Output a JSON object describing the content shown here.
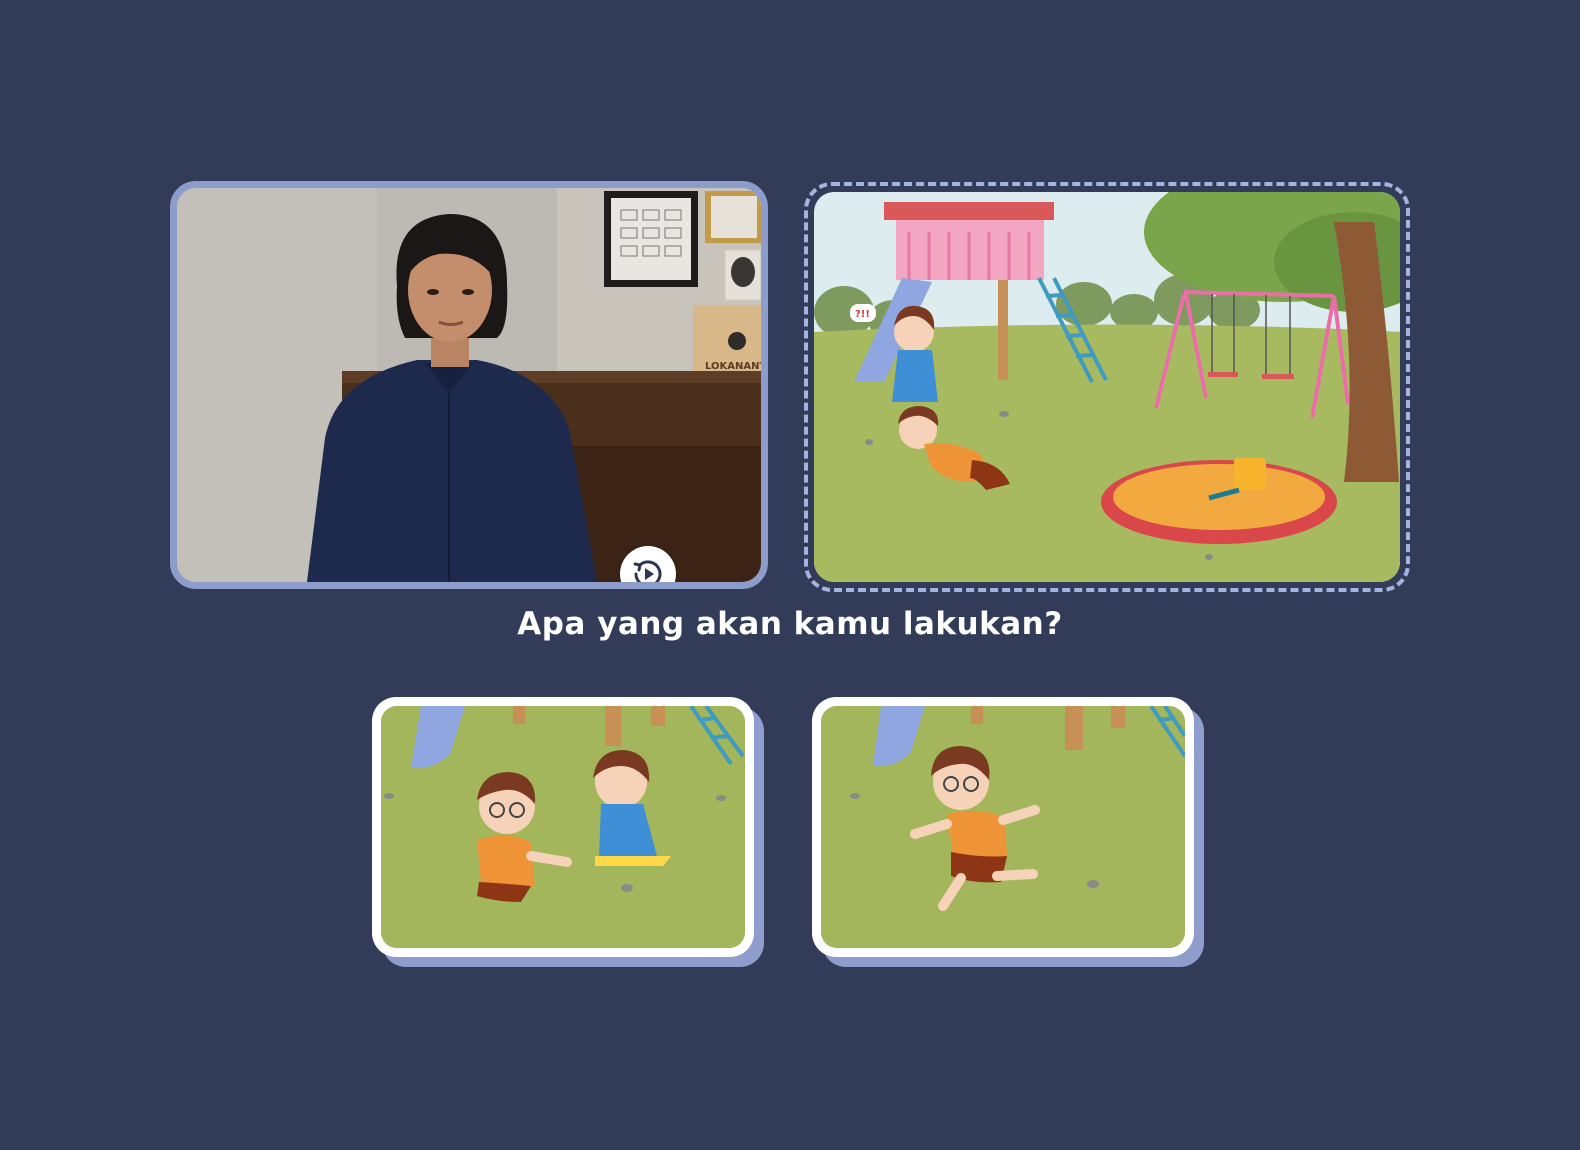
{
  "video": {
    "replay_icon": "replay-icon",
    "sign_text": "LOKANANT"
  },
  "scene": {
    "speech_bubble": "?!!"
  },
  "question": "Apa yang akan kamu lakukan?",
  "options": [
    {
      "id": "help-friend",
      "icon": "help-friend-illustration"
    },
    {
      "id": "run-away",
      "icon": "run-away-illustration"
    }
  ],
  "colors": {
    "background": "#323c58",
    "video_border": "#8c9ccb",
    "dashed_border": "#a5b3df",
    "card_shadow": "#8f9dcc",
    "grass": "#a3b65b"
  }
}
